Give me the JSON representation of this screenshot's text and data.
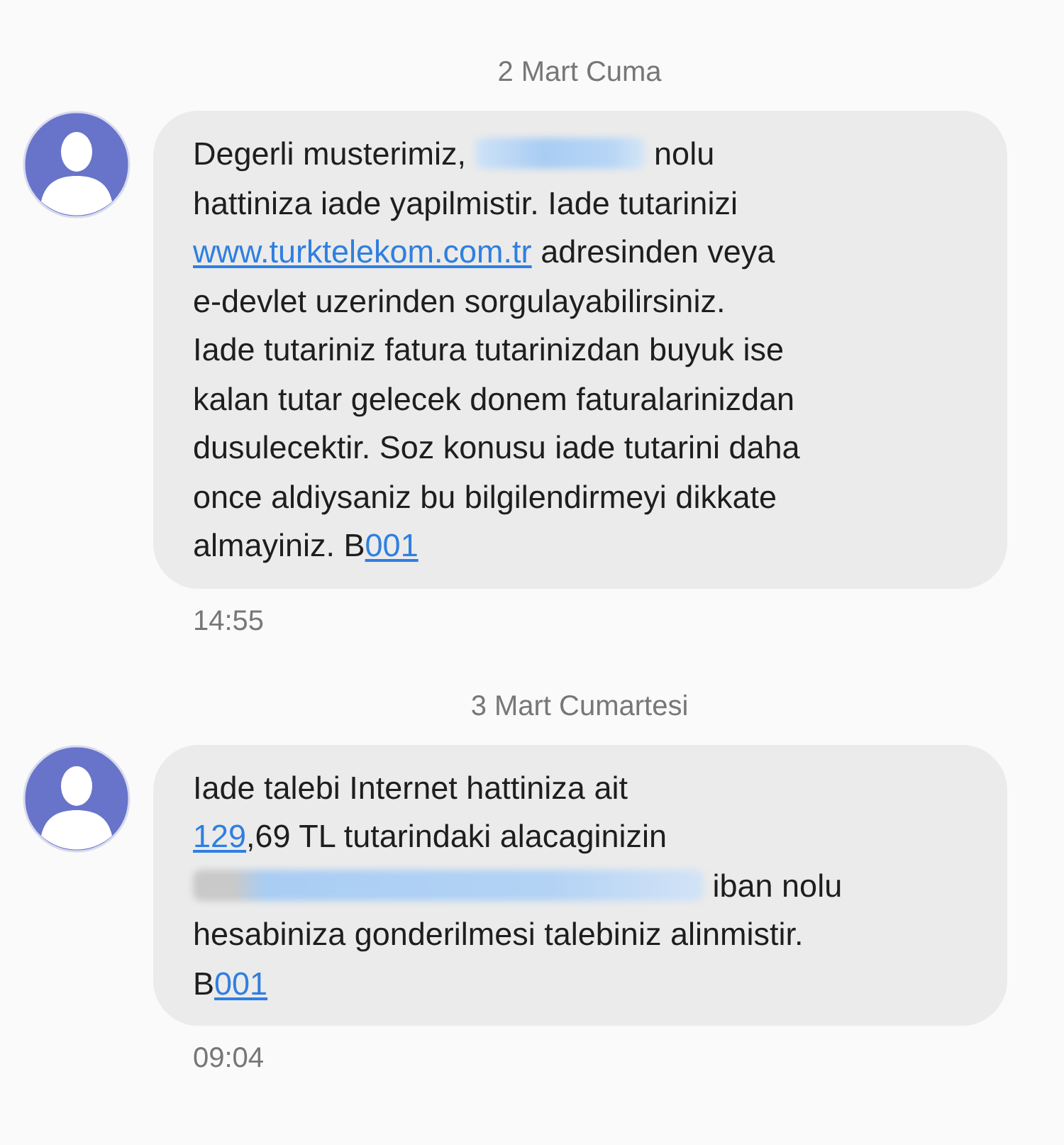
{
  "conversation": [
    {
      "date": "2 Mart Cuma",
      "time": "14:55",
      "body": [
        {
          "kind": "text",
          "text": "Degerli musterimiz, "
        },
        {
          "kind": "redacted_number"
        },
        {
          "kind": "text",
          "text": " nolu"
        },
        {
          "kind": "break"
        },
        {
          "kind": "text",
          "text": "hattiniza iade yapilmistir. Iade tutarinizi"
        },
        {
          "kind": "break"
        },
        {
          "kind": "link",
          "text": "www.turktelekom.com.tr"
        },
        {
          "kind": "text",
          "text": " adresinden veya"
        },
        {
          "kind": "break"
        },
        {
          "kind": "text",
          "text": "e-devlet uzerinden sorgulayabilirsiniz."
        },
        {
          "kind": "break"
        },
        {
          "kind": "text",
          "text": "Iade tutariniz fatura tutarinizdan buyuk ise"
        },
        {
          "kind": "break"
        },
        {
          "kind": "text",
          "text": "kalan tutar gelecek donem faturalarinizdan"
        },
        {
          "kind": "break"
        },
        {
          "kind": "text",
          "text": "dusulecektir. Soz konusu iade tutarini daha"
        },
        {
          "kind": "break"
        },
        {
          "kind": "text",
          "text": "once aldiysaniz bu bilgilendirmeyi dikkate"
        },
        {
          "kind": "break"
        },
        {
          "kind": "text",
          "text": "almayiniz. B"
        },
        {
          "kind": "link",
          "text": "001"
        }
      ]
    },
    {
      "date": "3 Mart Cumartesi",
      "time": "09:04",
      "body": [
        {
          "kind": "text",
          "text": "Iade talebi Internet hattiniza ait"
        },
        {
          "kind": "break"
        },
        {
          "kind": "link",
          "text": "129"
        },
        {
          "kind": "text",
          "text": ",69 TL tutarindaki alacaginizin"
        },
        {
          "kind": "break"
        },
        {
          "kind": "redacted_iban"
        },
        {
          "kind": "text",
          "text": " iban nolu"
        },
        {
          "kind": "break"
        },
        {
          "kind": "text",
          "text": "hesabiniza gonderilmesi talebiniz alinmistir."
        },
        {
          "kind": "break"
        },
        {
          "kind": "text",
          "text": "B"
        },
        {
          "kind": "link",
          "text": "001"
        }
      ]
    }
  ]
}
